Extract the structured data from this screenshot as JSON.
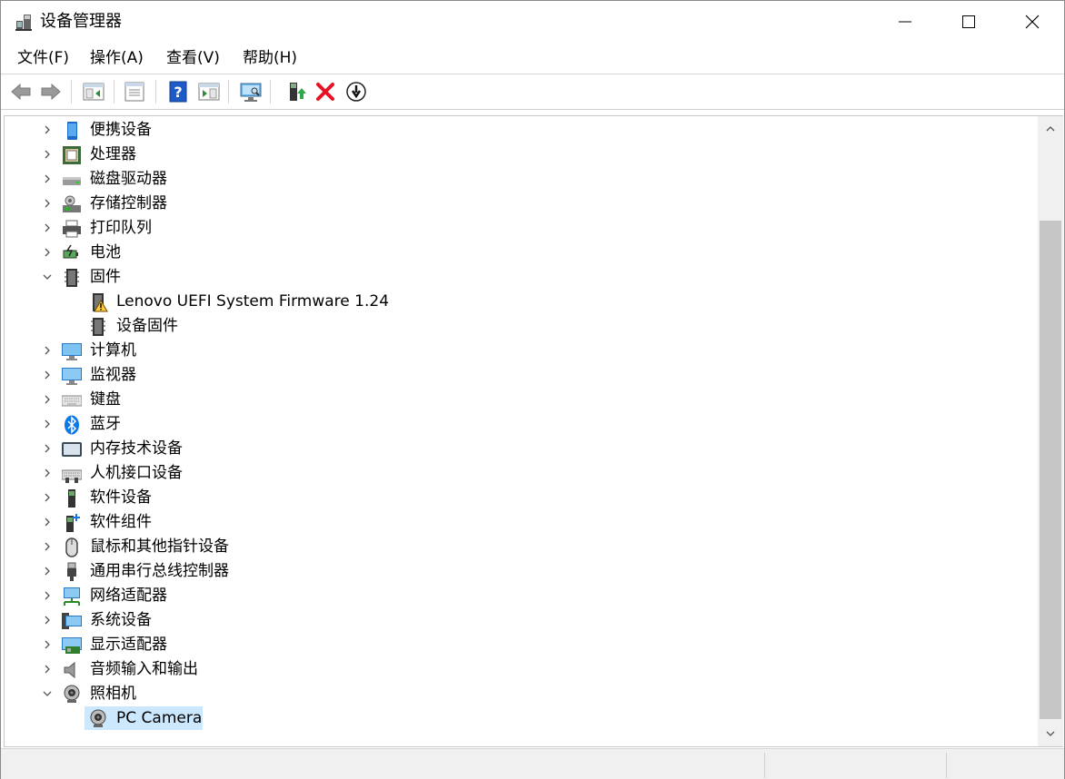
{
  "window": {
    "title": "设备管理器"
  },
  "menu": [
    "文件(F)",
    "操作(A)",
    "查看(V)",
    "帮助(H)"
  ],
  "toolbar": {
    "buttons": [
      "back-icon",
      "forward-icon",
      "show-hide-tree-icon",
      "properties-icon",
      "help-icon",
      "action-pane-icon",
      "scan-hardware-icon",
      "update-driver-icon",
      "uninstall-icon",
      "disable-icon"
    ]
  },
  "tree": {
    "items": [
      {
        "label": "便携设备",
        "expanded": false,
        "icon": "portable-device-icon"
      },
      {
        "label": "处理器",
        "expanded": false,
        "icon": "processor-icon"
      },
      {
        "label": "磁盘驱动器",
        "expanded": false,
        "icon": "disk-drive-icon"
      },
      {
        "label": "存储控制器",
        "expanded": false,
        "icon": "storage-controller-icon"
      },
      {
        "label": "打印队列",
        "expanded": false,
        "icon": "printer-icon"
      },
      {
        "label": "电池",
        "expanded": false,
        "icon": "battery-icon"
      },
      {
        "label": "固件",
        "expanded": true,
        "icon": "firmware-icon"
      },
      {
        "label": "Lenovo UEFI System Firmware 1.24",
        "child": true,
        "icon": "firmware-warning-icon"
      },
      {
        "label": "设备固件",
        "child": true,
        "icon": "firmware-icon"
      },
      {
        "label": "计算机",
        "expanded": false,
        "icon": "computer-icon"
      },
      {
        "label": "监视器",
        "expanded": false,
        "icon": "monitor-icon"
      },
      {
        "label": "键盘",
        "expanded": false,
        "icon": "keyboard-icon"
      },
      {
        "label": "蓝牙",
        "expanded": false,
        "icon": "bluetooth-icon"
      },
      {
        "label": "内存技术设备",
        "expanded": false,
        "icon": "memory-device-icon"
      },
      {
        "label": "人机接口设备",
        "expanded": false,
        "icon": "hid-icon"
      },
      {
        "label": "软件设备",
        "expanded": false,
        "icon": "software-device-icon"
      },
      {
        "label": "软件组件",
        "expanded": false,
        "icon": "software-component-icon"
      },
      {
        "label": "鼠标和其他指针设备",
        "expanded": false,
        "icon": "mouse-icon"
      },
      {
        "label": "通用串行总线控制器",
        "expanded": false,
        "icon": "usb-icon"
      },
      {
        "label": "网络适配器",
        "expanded": false,
        "icon": "network-adapter-icon"
      },
      {
        "label": "系统设备",
        "expanded": false,
        "icon": "system-device-icon"
      },
      {
        "label": "显示适配器",
        "expanded": false,
        "icon": "display-adapter-icon"
      },
      {
        "label": "音频输入和输出",
        "expanded": false,
        "icon": "audio-icon"
      },
      {
        "label": "照相机",
        "expanded": true,
        "icon": "camera-icon"
      },
      {
        "label": "PC Camera",
        "child": true,
        "selected": true,
        "icon": "camera-icon"
      }
    ]
  },
  "colors": {
    "selection": "#cce8ff",
    "uninstall_red": "#e81123",
    "help_blue": "#1e5bc6"
  }
}
